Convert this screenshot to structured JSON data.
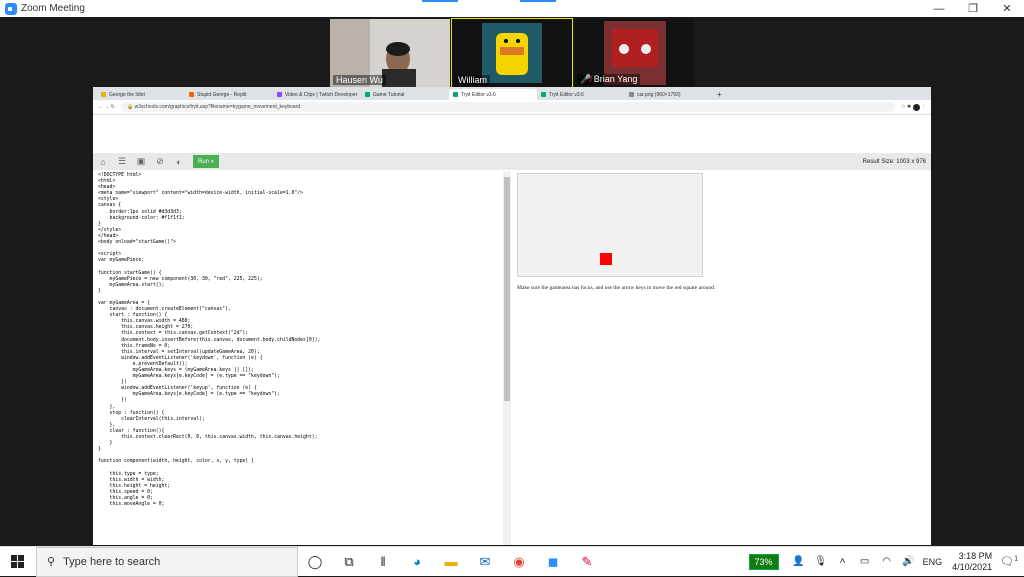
{
  "zoom": {
    "title": "Zoom Meeting",
    "participants": [
      {
        "name": "Hausen Wu"
      },
      {
        "name": "William"
      },
      {
        "name": "Brian Yang"
      }
    ]
  },
  "browser": {
    "tabs": [
      {
        "label": "George the Idiot",
        "color": "#e6b300"
      },
      {
        "label": "Stupid George - Replit",
        "color": "#f26207"
      },
      {
        "label": "Video & Clips | Twitch Developer",
        "color": "#9146ff"
      },
      {
        "label": "Game Tutorial",
        "color": "#04aa6d"
      },
      {
        "label": "Tryit Editor v3.6",
        "color": "#04aa6d"
      },
      {
        "label": "Tryit Editor v3.6",
        "color": "#04aa6d"
      },
      {
        "label": "car.png (960×1793)",
        "color": "#888888"
      }
    ],
    "url": "w3schools.com/graphics/tryit.asp?filename=trygame_movement_keyboard"
  },
  "editor": {
    "run_label": "Run »",
    "result_size": "Result Size: 1003 x 976",
    "code": "<!DOCTYPE html>\n<html>\n<head>\n<meta name=\"viewport\" content=\"width=device-width, initial-scale=1.0\"/>\n<style>\ncanvas {\n    border:1px solid #d3d3d3;\n    background-color: #f1f1f1;\n}\n</style>\n</head>\n<body onload=\"startGame()\">\n\n<script>\nvar myGamePiece;\n\nfunction startGame() {\n    myGamePiece = new component(30, 30, \"red\", 225, 225);\n    myGameArea.start();\n}\n\nvar myGameArea = {\n    canvas : document.createElement(\"canvas\"),\n    start : function() {\n        this.canvas.width = 480;\n        this.canvas.height = 270;\n        this.context = this.canvas.getContext(\"2d\");\n        document.body.insertBefore(this.canvas, document.body.childNodes[0]);\n        this.frameNo = 0;\n        this.interval = setInterval(updateGameArea, 20);\n        window.addEventListener('keydown', function (e) {\n            e.preventDefault();\n            myGameArea.keys = (myGameArea.keys || []);\n            myGameArea.keys[e.keyCode] = (e.type == \"keydown\");\n        })\n        window.addEventListener('keyup', function (e) {\n            myGameArea.keys[e.keyCode] = (e.type == \"keydown\");\n        })\n    },\n    stop : function() {\n        clearInterval(this.interval);\n    },\n    clear : function(){\n        this.context.clearRect(0, 0, this.canvas.width, this.canvas.height);\n    }\n}\n\nfunction component(width, height, color, x, y, type) {\n\n    this.type = type;\n    this.width = width;\n    this.height = height;\n    this.speed = 0;\n    this.angle = 0;\n    this.moveAngle = 0;",
    "result_text": "Make sure the gamearea has focus, and use the arrow keys to move the red square around."
  },
  "taskbar": {
    "search_placeholder": "Type here to search",
    "battery": "73%",
    "language": "ENG",
    "time": "3:18 PM",
    "date": "4/10/2021",
    "notification_count": "1"
  }
}
